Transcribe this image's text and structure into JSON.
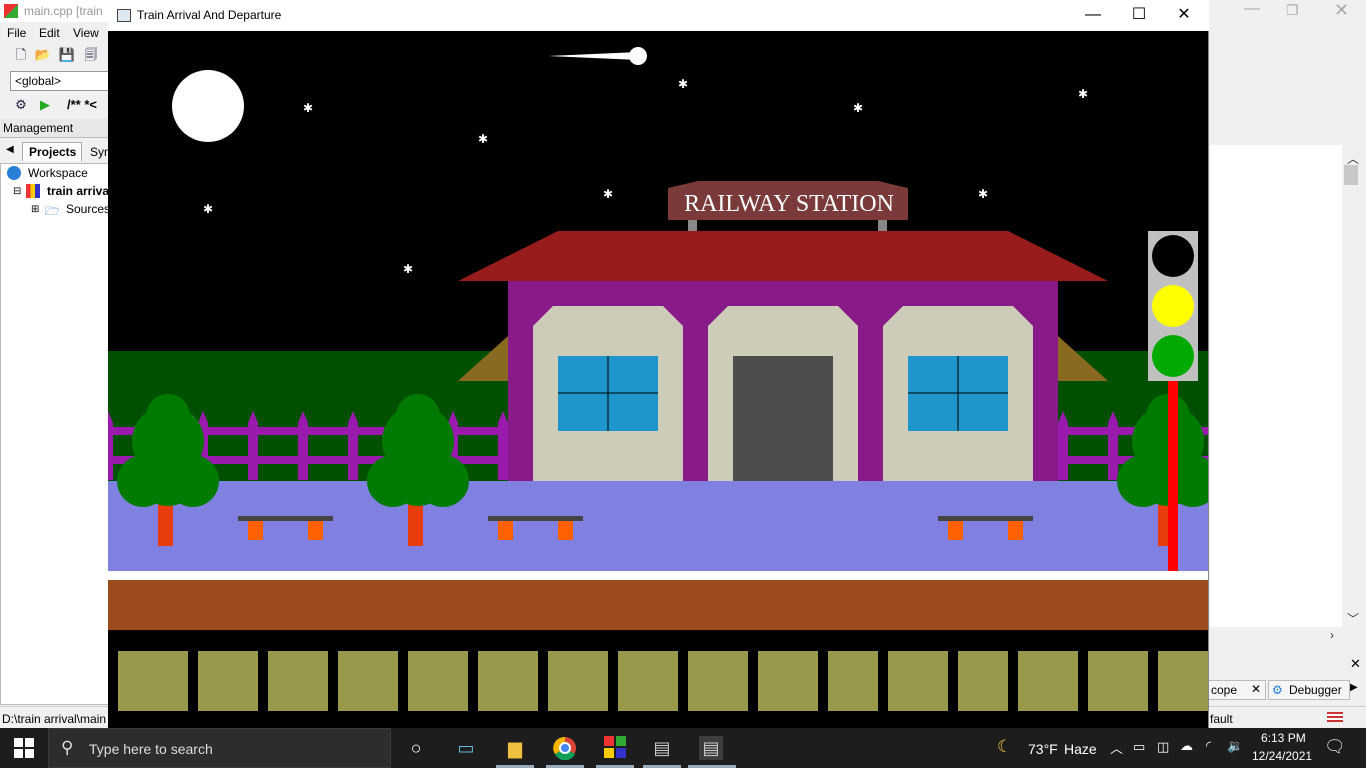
{
  "ide": {
    "title": "main.cpp [train",
    "menu": [
      "File",
      "Edit",
      "View"
    ],
    "scope_combo": "<global>",
    "toolbar_comment": "/** *<",
    "management_label": "Management",
    "tabs": [
      "Projects",
      "Sym"
    ],
    "tree": [
      "Workspace",
      "train arriva",
      "Sources"
    ],
    "status_path": "D:\\train arrival\\main",
    "bottom_tabs": [
      "cope",
      "Debugger"
    ],
    "status_right": "fault"
  },
  "app_window": {
    "title": "Train Arrival And Departure",
    "minimize_icon": "minimize-icon",
    "maximize_icon": "maximize-icon",
    "close_icon": "close-icon"
  },
  "scene": {
    "station_sign": "RAILWAY STATION",
    "colors": {
      "sky": "#000000",
      "moon": "#ffffff",
      "roof": "#991c1c",
      "building": "#881b88",
      "panel": "#ccccb8",
      "window": "#1e96cc",
      "door": "#4d4d4d",
      "platform": "#8080e0",
      "track": "#9b4b1c",
      "sleeper": "#99994d",
      "tree": "#007a00",
      "trunk": "#e83c0c",
      "fence": "#9a1aae",
      "hedge": "#005000",
      "signal_red": "#ff0000",
      "signal_yellow": "#ffff00",
      "signal_green": "#00aa00",
      "bench_leg": "#ff6000",
      "sign_bg": "#7a3a3a"
    }
  },
  "taskbar": {
    "search_placeholder": "Type here to search",
    "weather_temp": "73°F",
    "weather_desc": "Haze",
    "time": "6:13 PM",
    "date": "12/24/2021"
  }
}
